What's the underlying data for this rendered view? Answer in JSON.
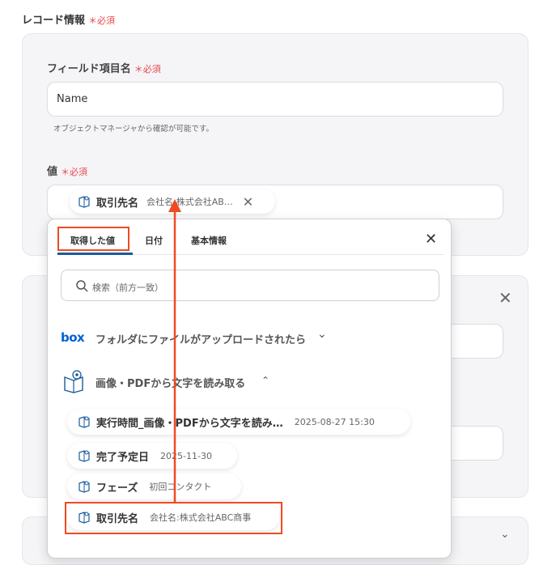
{
  "section": {
    "title": "レコード情報",
    "required": "＊必須"
  },
  "field_name": {
    "label": "フィールド項目名",
    "required": "＊必須",
    "value": "Name",
    "hint": "オブジェクトマネージャから確認が可能です。"
  },
  "value_field": {
    "label": "値",
    "required": "＊必須",
    "chip": {
      "name": "取引先名",
      "value": "会社名:株式会社AB…"
    }
  },
  "popup": {
    "tabs": [
      {
        "label": "取得した値"
      },
      {
        "label": "日付"
      },
      {
        "label": "基本情報"
      }
    ],
    "search_placeholder": "検索（前方一致）",
    "groups": [
      {
        "logo": "box",
        "label": "フォルダにファイルがアップロードされたら"
      },
      {
        "label": "画像・PDFから文字を読み取る"
      }
    ],
    "items": [
      {
        "name": "実行時間_画像・PDFから文字を読み…",
        "value": "2025-08-27 15:30"
      },
      {
        "name": "完了予定日",
        "value": "2025-11-30"
      },
      {
        "name": "フェーズ",
        "value": "初回コンタクト"
      },
      {
        "name": "取引先名",
        "value": "会社名:株式会社ABC商事"
      }
    ]
  },
  "colors": {
    "accent": "#1a5b9c",
    "highlight": "#ee4b22",
    "required": "#e5484d",
    "box_blue": "#0061d5"
  }
}
